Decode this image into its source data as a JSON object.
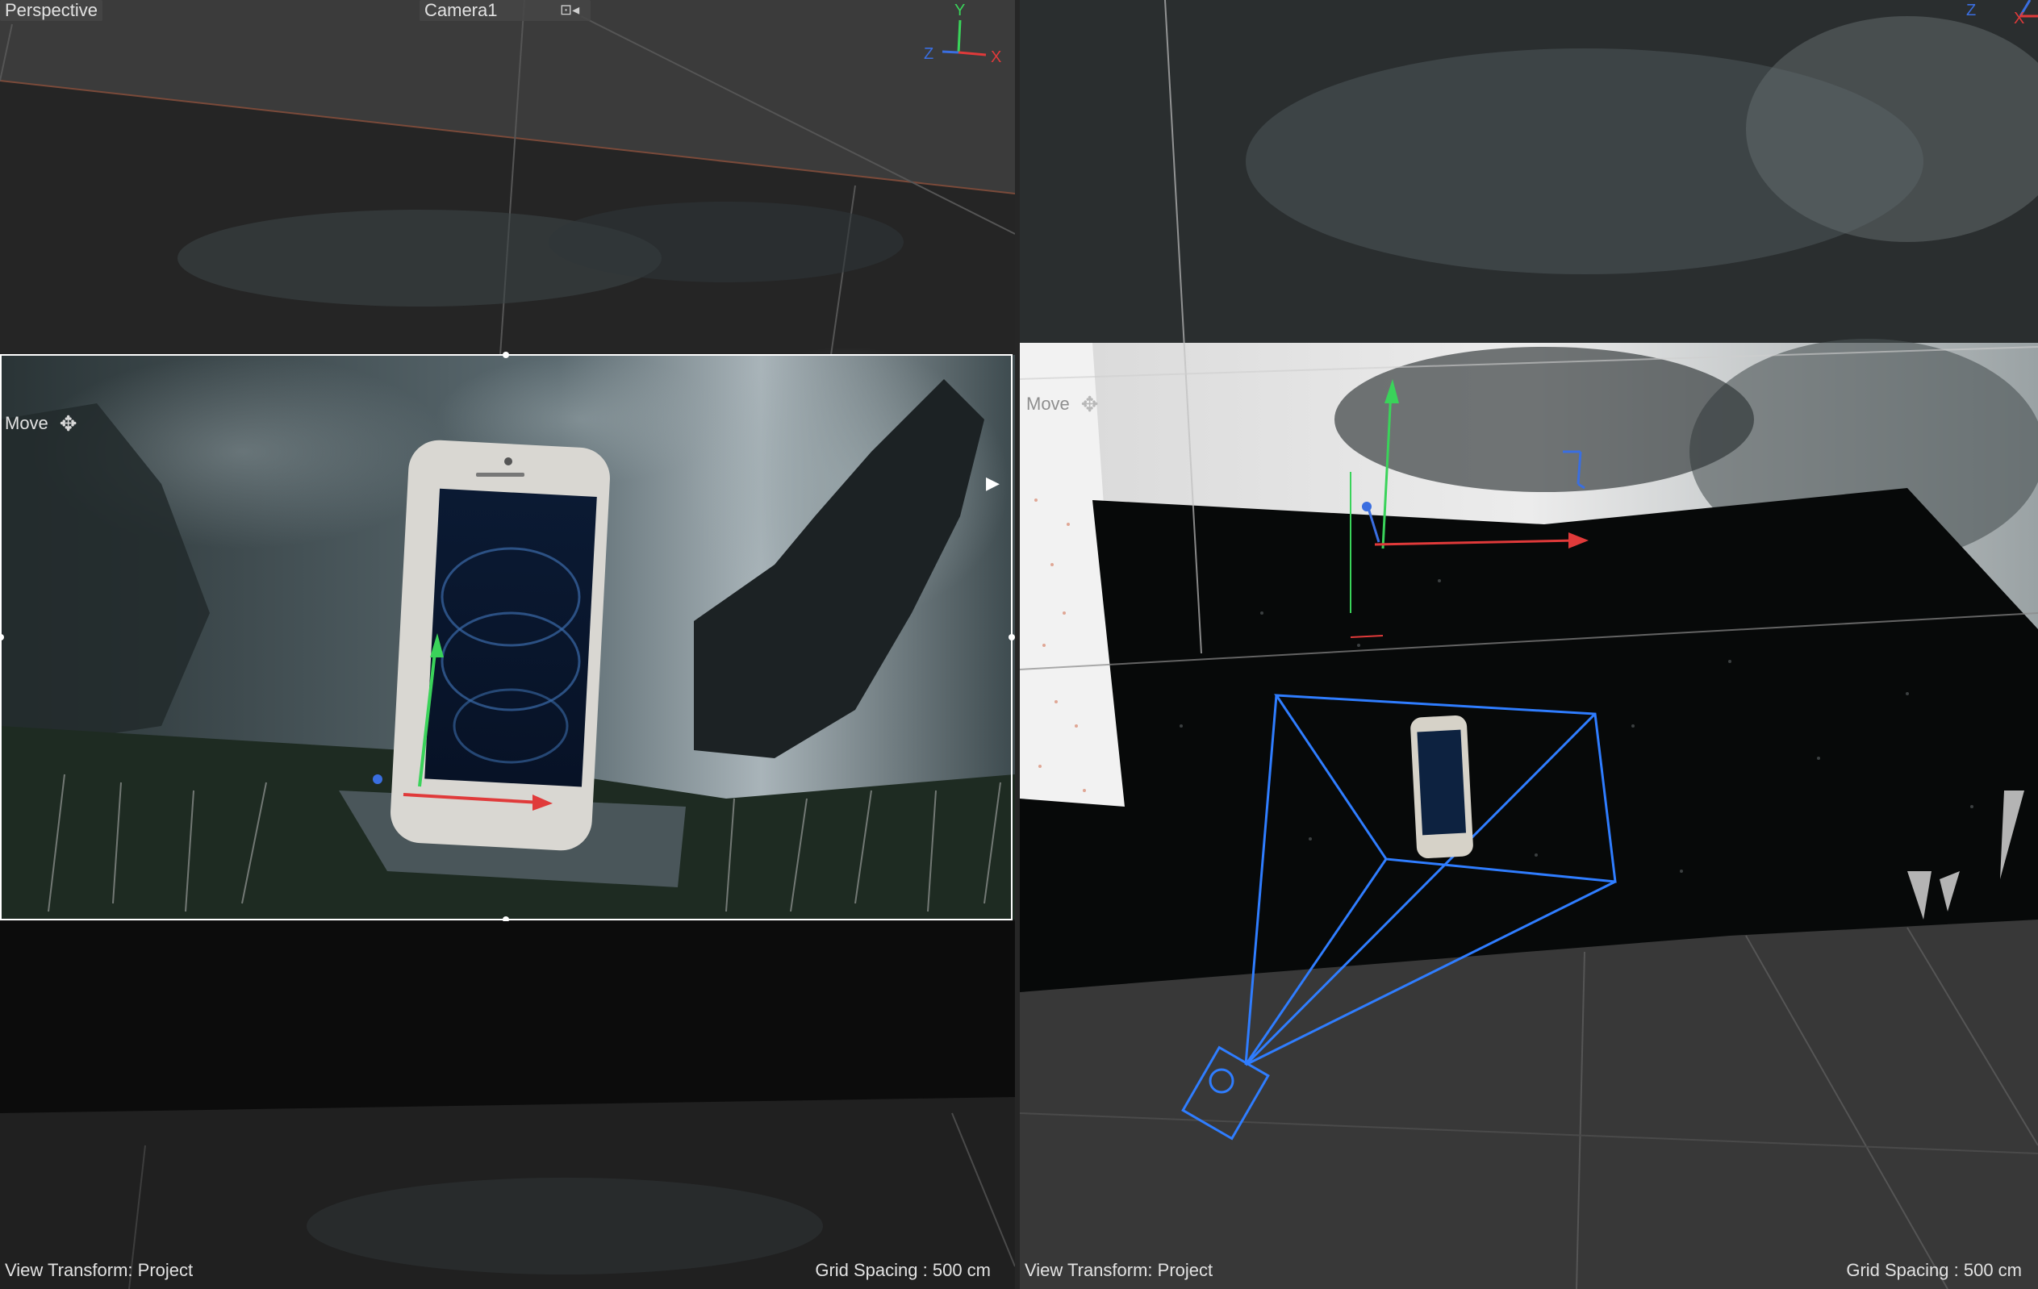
{
  "left_viewport": {
    "view_name": "Perspective",
    "camera_name": "Camera1",
    "tool_label": "Move",
    "view_transform": "View Transform: Project",
    "grid_spacing": "Grid Spacing : 500 cm",
    "axis_labels": {
      "y": "Y",
      "z": "Z",
      "x": "X"
    }
  },
  "right_viewport": {
    "tool_label": "Move",
    "view_transform": "View Transform: Project",
    "grid_spacing": "Grid Spacing : 500 cm",
    "axis_labels": {
      "z": "Z",
      "x": "X"
    }
  },
  "icons": {
    "move_tool": "move-arrows-icon",
    "camera_lock": "camera-lock-icon",
    "play_arrow": "play-arrow-icon"
  },
  "colors": {
    "axis_x": "#e03a3a",
    "axis_y": "#3ad35a",
    "axis_z": "#3a6ee0",
    "camera_frustum": "#2f7dff",
    "selection_frame": "#ffffff"
  }
}
